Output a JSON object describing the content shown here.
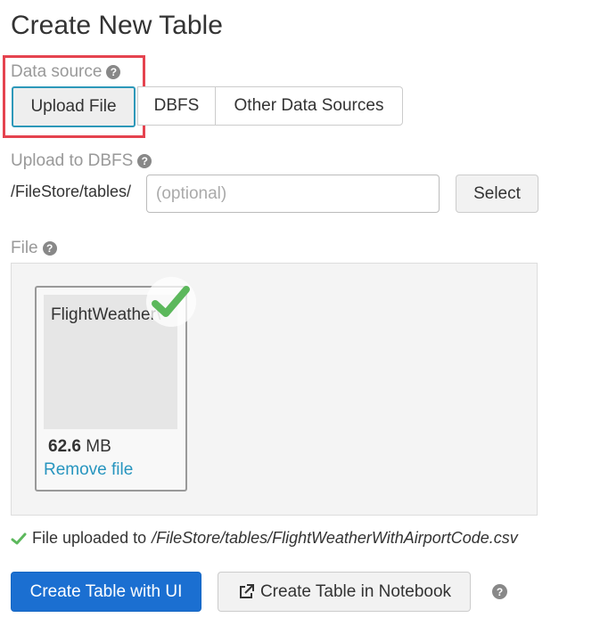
{
  "page": {
    "title": "Create New Table"
  },
  "data_source": {
    "label": "Data source",
    "tabs": [
      {
        "label": "Upload File",
        "active": true
      },
      {
        "label": "DBFS",
        "active": false
      },
      {
        "label": "Other Data Sources",
        "active": false
      }
    ]
  },
  "upload_to_dbfs": {
    "label": "Upload to DBFS",
    "path_prefix": "/FileStore/tables/",
    "input_placeholder": "(optional)",
    "input_value": "",
    "select_button": "Select"
  },
  "file": {
    "label": "File",
    "name": "FlightWeather",
    "name_tail": "\\",
    "size_value": "62.6",
    "size_unit": "MB",
    "remove_link": "Remove file"
  },
  "status": {
    "prefix": "File uploaded to",
    "path": "/FileStore/tables/FlightWeatherWithAirportCode.csv"
  },
  "actions": {
    "create_ui": "Create Table with UI",
    "create_notebook": "Create Table in Notebook"
  },
  "colors": {
    "primary": "#1b6fd1",
    "active_tab_border": "#2d98b9",
    "highlight": "#e5434f",
    "success": "#5cb85c",
    "link": "#2795bf"
  }
}
